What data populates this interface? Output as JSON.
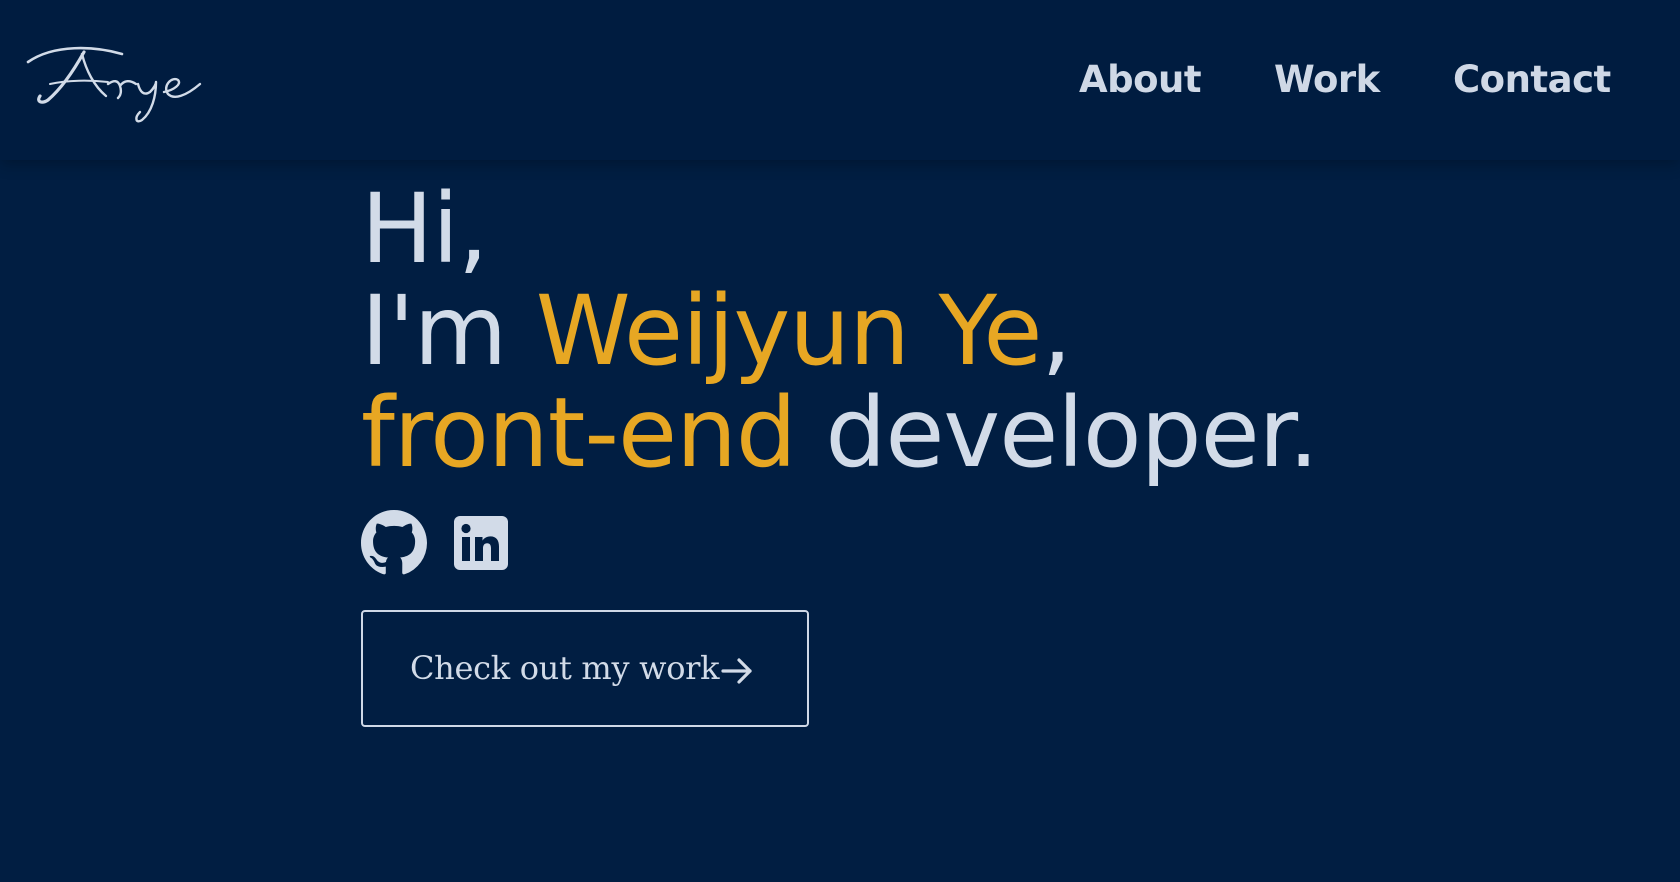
{
  "brand": {
    "logo_text": "Arye"
  },
  "nav": {
    "items": [
      {
        "label": "About"
      },
      {
        "label": "Work"
      },
      {
        "label": "Contact"
      }
    ]
  },
  "hero": {
    "greeting": "Hi,",
    "intro_prefix": "I'm ",
    "name": "Weijyun Ye",
    "name_suffix": ",",
    "role_highlight": "front-end",
    "role_rest": " developer."
  },
  "socials": [
    {
      "icon": "github-icon"
    },
    {
      "icon": "linkedin-icon"
    }
  ],
  "cta": {
    "label": "Check out my work",
    "icon": "arrow-right-icon"
  },
  "colors": {
    "background": "#011e42",
    "navbar": "#001c40",
    "text": "#d2dbe8",
    "accent": "#e7a723"
  }
}
